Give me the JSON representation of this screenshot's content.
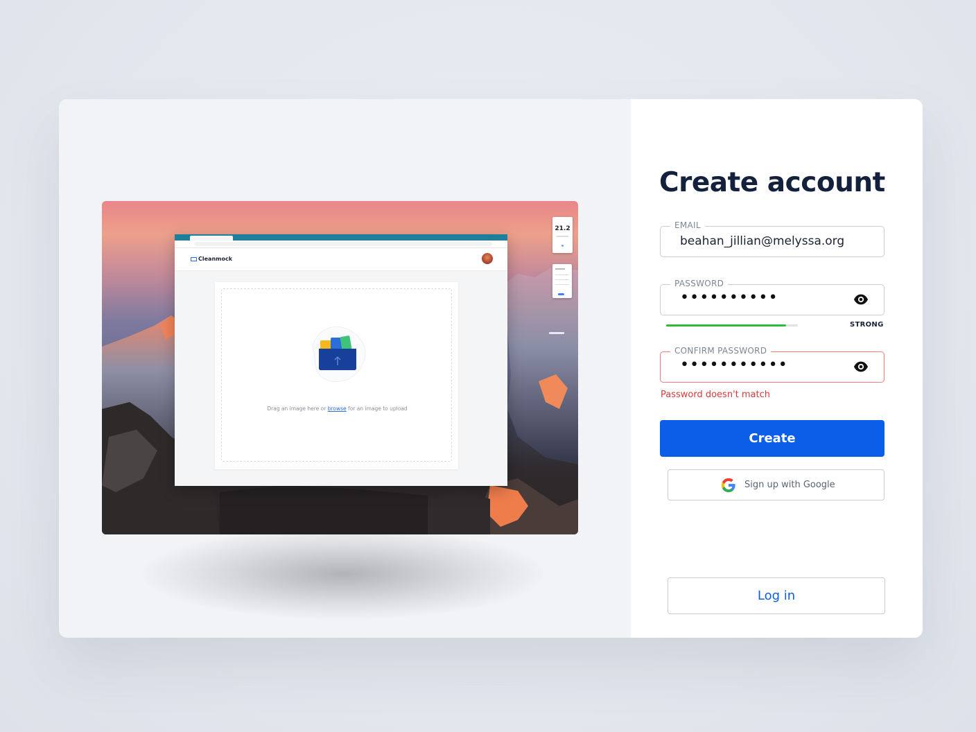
{
  "form": {
    "title": "Create account",
    "email": {
      "label": "EMAIL",
      "value": "beahan_jillian@melyssa.org"
    },
    "password": {
      "label": "PASSWORD",
      "masked_value": "••••••••••",
      "strength_label": "STRONG",
      "strength_level": 0.91
    },
    "confirm_password": {
      "label": "CONFIRM PASSWORD",
      "masked_value": "•••••••••••",
      "error": "Password doesn't match"
    },
    "create_label": "Create",
    "google_label": "Sign up with Google",
    "login_label": "Log in"
  },
  "preview": {
    "brand": "Cleanmock",
    "upload_text_before": "Drag an image here or ",
    "upload_link": "browse",
    "upload_text_after": " for an image to upload",
    "widget_value": "21.2"
  },
  "colors": {
    "primary": "#0a5ee8",
    "error": "#d63a3a",
    "strength": "#2ebd39",
    "title": "#14213d"
  },
  "icons": {
    "password_toggle": "eye-icon",
    "google": "google-icon",
    "upload": "folder-upload-icon"
  }
}
